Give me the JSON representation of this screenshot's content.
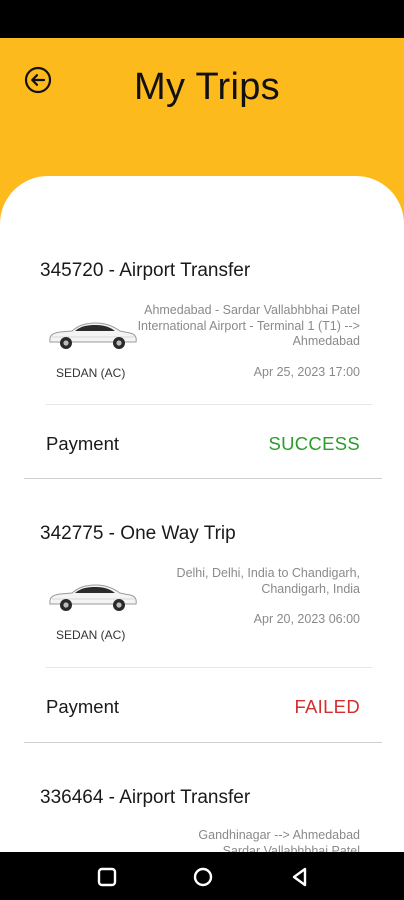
{
  "header": {
    "title": "My Trips",
    "back_icon": "arrow-left-circle-icon",
    "accent_color": "#FDBA1C"
  },
  "trips": [
    {
      "title": "345720 - Airport Transfer",
      "car_type": "SEDAN (AC)",
      "route": "Ahmedabad - Sardar Vallabhbhai Patel International Airport - Terminal 1 (T1) --> Ahmedabad",
      "datetime": "Apr 25, 2023 17:00",
      "payment_label": "Payment",
      "payment_status": "SUCCESS",
      "status_color": "#2a9d2a"
    },
    {
      "title": "342775 - One Way Trip",
      "car_type": "SEDAN (AC)",
      "route": "Delhi, Delhi, India to Chandigarh, Chandigarh, India",
      "datetime": "Apr 20, 2023 06:00",
      "payment_label": "Payment",
      "payment_status": "FAILED",
      "status_color": "#d32f2f"
    },
    {
      "title": "336464 - Airport Transfer",
      "route": "Gandhinagar --> Ahmedabad Sardar Vallabhbhai Patel"
    }
  ],
  "nav": {
    "recents_icon": "square-recents-icon",
    "home_icon": "circle-home-icon",
    "back_icon": "triangle-back-icon"
  }
}
